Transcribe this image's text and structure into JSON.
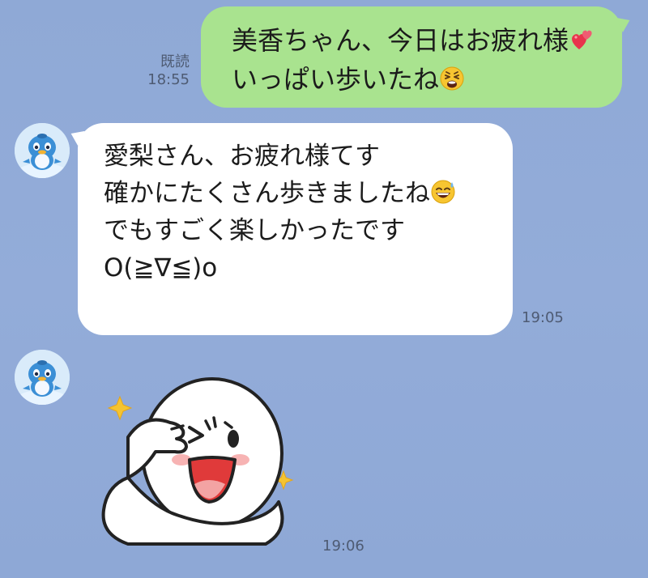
{
  "messages": {
    "outgoing": {
      "line1": "美香ちゃん、今日はお疲れ様",
      "line1_emoji": "two-hearts-icon",
      "line2": "いっぱい歩いたね",
      "line2_emoji": "weary-face-icon",
      "read_label": "既読",
      "time": "18:55"
    },
    "incoming": {
      "line1": "愛梨さん、お疲れ様てす",
      "line2": "確かにたくさん歩きましたね",
      "line2_emoji": "grinning-sweat-icon",
      "line3": "でもすごく楽しかったです",
      "line4": "O(≧∇≦)o",
      "time": "19:05"
    },
    "sticker": {
      "icon": "sticker-character-icon",
      "time": "19:06"
    }
  },
  "colors": {
    "background": "#8fa9d6",
    "outgoing_bubble": "#a9e38f",
    "incoming_bubble": "#ffffff",
    "meta_text": "#4e5b73"
  }
}
